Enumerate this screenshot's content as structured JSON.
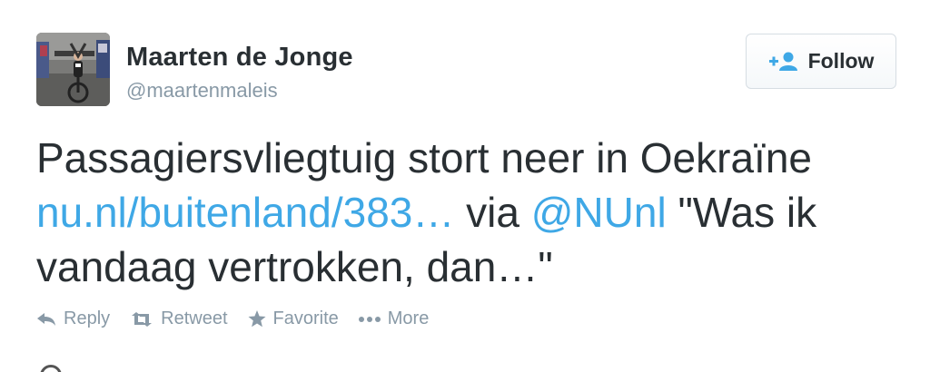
{
  "user": {
    "fullname": "Maarten de Jonge",
    "screen_name": "@maartenmaleis",
    "avatar_icon": "profile-photo-cyclist"
  },
  "follow_button": {
    "label": "Follow",
    "icon": "add-user-icon"
  },
  "tweet": {
    "text_part1": "Passagiersvliegtuig stort neer in Oekraïne ",
    "link": "nu.nl/buitenland/383…",
    "text_part2": " via ",
    "mention": "@NUnl",
    "text_part3": " \"Was ik vandaag vertrokken, dan…\""
  },
  "actions": [
    {
      "label": "Reply",
      "icon": "reply-icon"
    },
    {
      "label": "Retweet",
      "icon": "retweet-icon"
    },
    {
      "label": "Favorite",
      "icon": "star-icon"
    },
    {
      "label": "More",
      "icon": "more-dots-icon"
    }
  ],
  "colors": {
    "link": "#3fa8e6",
    "text": "#292f33",
    "muted": "#8899a6"
  }
}
